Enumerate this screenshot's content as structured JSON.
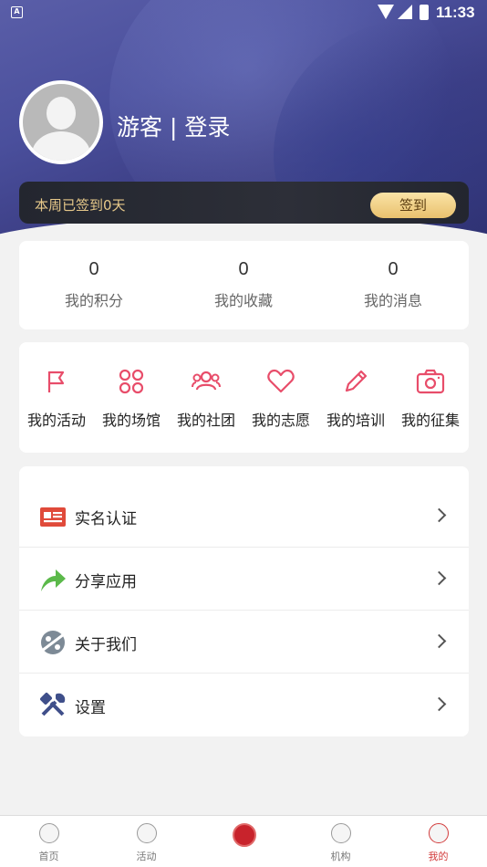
{
  "status_bar": {
    "time": "11:33"
  },
  "profile": {
    "name": "游客 | 登录"
  },
  "checkin": {
    "text": "本周已签到0天",
    "button": "签到"
  },
  "stats": [
    {
      "value": "0",
      "label": "我的积分"
    },
    {
      "value": "0",
      "label": "我的收藏"
    },
    {
      "value": "0",
      "label": "我的消息"
    }
  ],
  "features": [
    {
      "label": "我的活动",
      "icon": "flag-icon"
    },
    {
      "label": "我的场馆",
      "icon": "venue-icon"
    },
    {
      "label": "我的社团",
      "icon": "group-icon"
    },
    {
      "label": "我的志愿",
      "icon": "heart-icon"
    },
    {
      "label": "我的培训",
      "icon": "pencil-icon"
    },
    {
      "label": "我的征集",
      "icon": "camera-icon"
    }
  ],
  "menu": [
    {
      "label": "实名认证",
      "icon": "id-card-icon",
      "color": "#e04a3a"
    },
    {
      "label": "分享应用",
      "icon": "share-arrow-icon",
      "color": "#5bb94a"
    },
    {
      "label": "关于我们",
      "icon": "planet-icon",
      "color": "#7d8a96"
    },
    {
      "label": "设置",
      "icon": "tools-icon",
      "color": "#3f4f8a"
    }
  ],
  "tabs": [
    {
      "label": "首页"
    },
    {
      "label": "活动"
    },
    {
      "label": ""
    },
    {
      "label": "机构"
    },
    {
      "label": "我的"
    }
  ],
  "colors": {
    "accent": "#e84d6a",
    "active_tab": "#d23b3b",
    "header": "#4a4f9c"
  }
}
